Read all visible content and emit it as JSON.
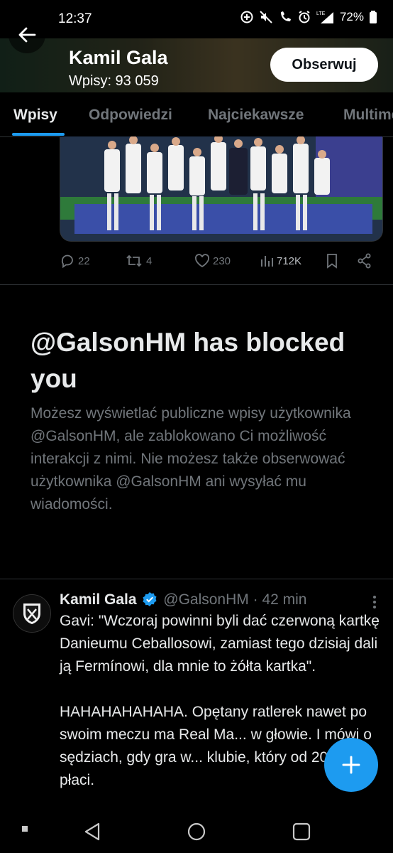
{
  "status_bar": {
    "time": "12:37",
    "battery": "72%",
    "icons": [
      "data-saver-icon",
      "mute-icon",
      "wifi-call-icon",
      "alarm-icon",
      "lte-signal-icon",
      "battery-icon"
    ]
  },
  "header": {
    "name": "Kamil Gala",
    "post_count": "Wpisy: 93 059",
    "follow_label": "Obserwuj"
  },
  "tabs": [
    {
      "label": "Wpisy",
      "active": true
    },
    {
      "label": "Odpowiedzi",
      "active": false
    },
    {
      "label": "Najciekawsze",
      "active": false
    },
    {
      "label": "Multimedia",
      "active": false
    }
  ],
  "prev_post": {
    "replies": "22",
    "reposts": "4",
    "likes": "230",
    "views": "712K"
  },
  "blocked": {
    "title": "@GalsonHM has blocked you",
    "description": "Możesz wyświetlać publiczne wpisy użytkownika @GalsonHM, ale zablokowano Ci możliwość interakcji z nimi. Nie możesz także obserwować użytkownika @GalsonHM ani wysyłać mu wiadomości."
  },
  "tweet": {
    "name": "Kamil Gala",
    "handle": "@GalsonHM",
    "separator": "·",
    "time": "42 min",
    "text": "Gavi: \"Wczoraj powinni byli dać czerwoną kartkę Danieumu Ceballosowi, zamiast tego dzisiaj dali ją Fermínowi, dla mnie to żółta kartka\".\n\nHAHAHAHAHAHA. Opętany ratlerek nawet po swoim meczu ma Real Ma... w głowie. I mówi o sędziach, gdy gra w... klubie, który od 20 lat im płaci."
  },
  "colors": {
    "accent": "#1d9bf0",
    "background": "#000000",
    "text_primary": "#e7e9ea",
    "text_secondary": "#71767b"
  }
}
